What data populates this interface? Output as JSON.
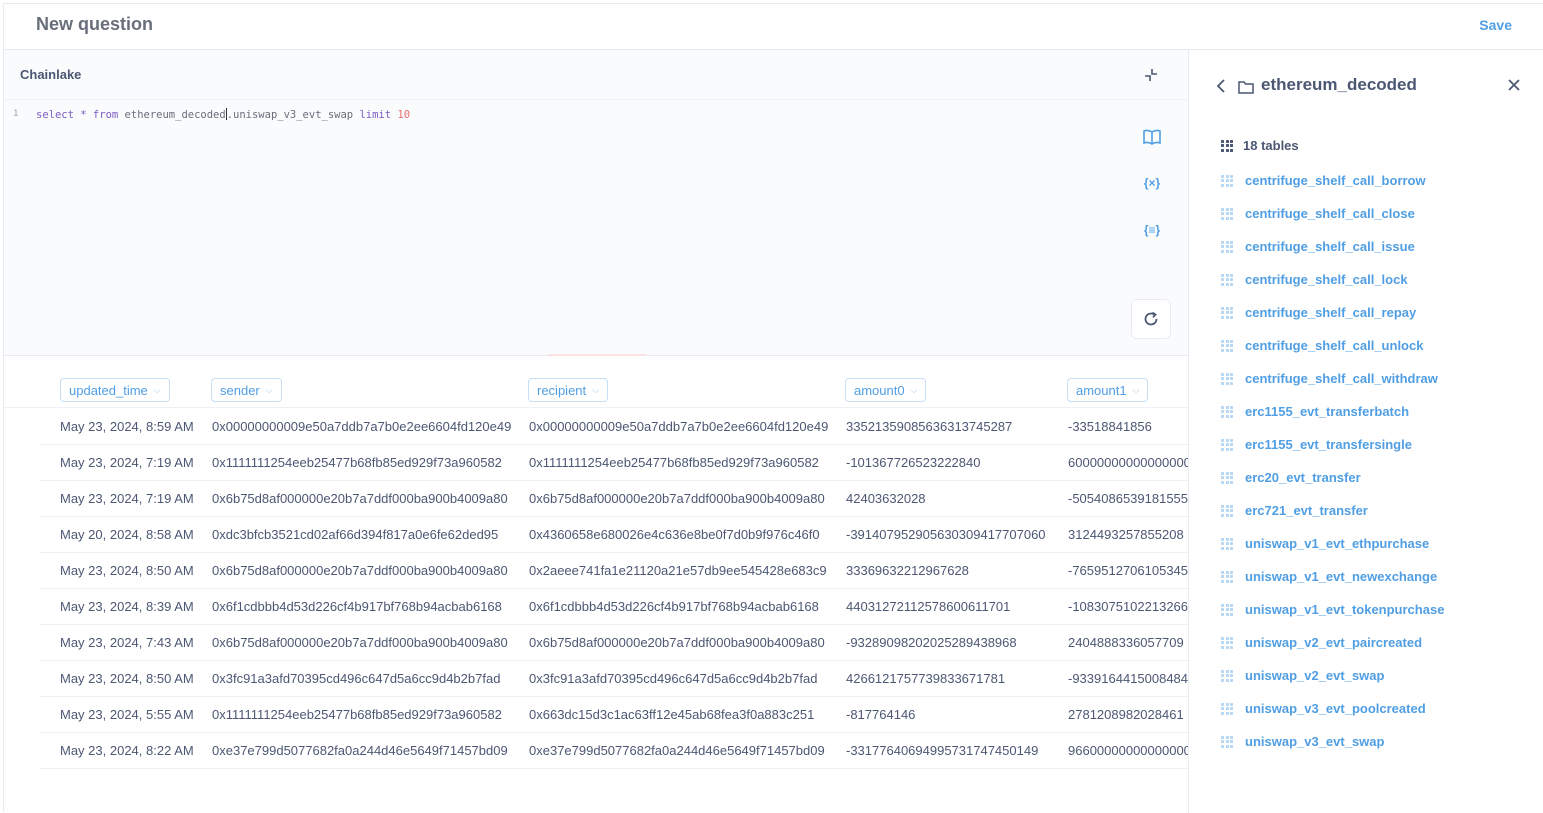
{
  "header": {
    "title": "New question",
    "save_label": "Save"
  },
  "editor": {
    "database": "Chainlake",
    "line_number": "1",
    "query_parts": {
      "select": "select",
      "star": "*",
      "from": "from",
      "table_a": "ethereum_decoded",
      "table_b": ".uniswap_v3_evt_swap",
      "limit": "limit",
      "limit_value": "10"
    },
    "tools": {
      "variables": "{×}",
      "snippets": "{≡}"
    }
  },
  "results": {
    "columns": [
      "updated_time",
      "sender",
      "recipient",
      "amount0",
      "amount1"
    ],
    "rows": [
      [
        "May 23, 2024, 8:59 AM",
        "0x00000000009e50a7ddb7a7b0e2ee6604fd120e49",
        "0x00000000009e50a7ddb7a7b0e2ee6604fd120e49",
        "33521359085636313745287",
        "-33518841856"
      ],
      [
        "May 23, 2024, 7:19 AM",
        "0x1111111254eeb25477b68fb85ed929f73a960582",
        "0x1111111254eeb25477b68fb85ed929f73a960582",
        "-101367726523222840",
        "60000000000000000"
      ],
      [
        "May 23, 2024, 7:19 AM",
        "0x6b75d8af000000e20b7a7ddf000ba900b4009a80",
        "0x6b75d8af000000e20b7a7ddf000ba900b4009a80",
        "42403632028",
        "-5054086539181555"
      ],
      [
        "May 20, 2024, 8:58 AM",
        "0xdc3bfcb3521cd02af66d394f817a0e6fe62ded95",
        "0x4360658e680026e4c636e8be0f7d0b9f976c46f0",
        "-3914079529056303094177070​60",
        "3124493257855208"
      ],
      [
        "May 23, 2024, 8:50 AM",
        "0x6b75d8af000000e20b7a7ddf000ba900b4009a80",
        "0x2aeee741fa1e21120a21e57db9ee545428e683c9",
        "33369632212967628",
        "-7659512706105345"
      ],
      [
        "May 23, 2024, 8:39 AM",
        "0x6f1cdbbb4d53d226cf4b917bf768b94acbab6168",
        "0x6f1cdbbb4d53d226cf4b917bf768b94acbab6168",
        "4403127211257860061170​1",
        "-1083075102213266"
      ],
      [
        "May 23, 2024, 7:43 AM",
        "0x6b75d8af000000e20b7a7ddf000ba900b4009a80",
        "0x6b75d8af000000e20b7a7ddf000ba900b4009a80",
        "-932890982020252894389​68",
        "2404888336057709"
      ],
      [
        "May 23, 2024, 8:50 AM",
        "0x3fc91a3afd70395cd496c647d5a6cc9d4b2b7fad",
        "0x3fc91a3afd70395cd496c647d5a6cc9d4b2b7fad",
        "4266121757739833671781",
        "-9339164415008484"
      ],
      [
        "May 23, 2024, 5:55 AM",
        "0x1111111254eeb25477b68fb85ed929f73a960582",
        "0x663dc15d3c1ac63ff12e45ab68fea3f0a883c251",
        "-817764146",
        "2781208982028461"
      ],
      [
        "May 23, 2024, 8:22 AM",
        "0xe37e799d5077682fa0a244d46e5649f71457bd09",
        "0xe37e799d5077682fa0a244d46e5649f71457bd09",
        "-3317764069499573174745​0149",
        "96600000000000000"
      ]
    ]
  },
  "panel": {
    "schema": "ethereum_decoded",
    "count": "18 tables",
    "tables": [
      "centrifuge_shelf_call_borrow",
      "centrifuge_shelf_call_close",
      "centrifuge_shelf_call_issue",
      "centrifuge_shelf_call_lock",
      "centrifuge_shelf_call_repay",
      "centrifuge_shelf_call_unlock",
      "centrifuge_shelf_call_withdraw",
      "erc1155_evt_transferbatch",
      "erc1155_evt_transfersingle",
      "erc20_evt_transfer",
      "erc721_evt_transfer",
      "uniswap_v1_evt_ethpurchase",
      "uniswap_v1_evt_newexchange",
      "uniswap_v1_evt_tokenpurchase",
      "uniswap_v2_evt_paircreated",
      "uniswap_v2_evt_swap",
      "uniswap_v3_evt_poolcreated",
      "uniswap_v3_evt_swap"
    ]
  },
  "colors": {
    "accent": "#509ee3",
    "text": "#4c5773",
    "editor_bg": "#f9fbfc",
    "border": "#e8ebef"
  }
}
